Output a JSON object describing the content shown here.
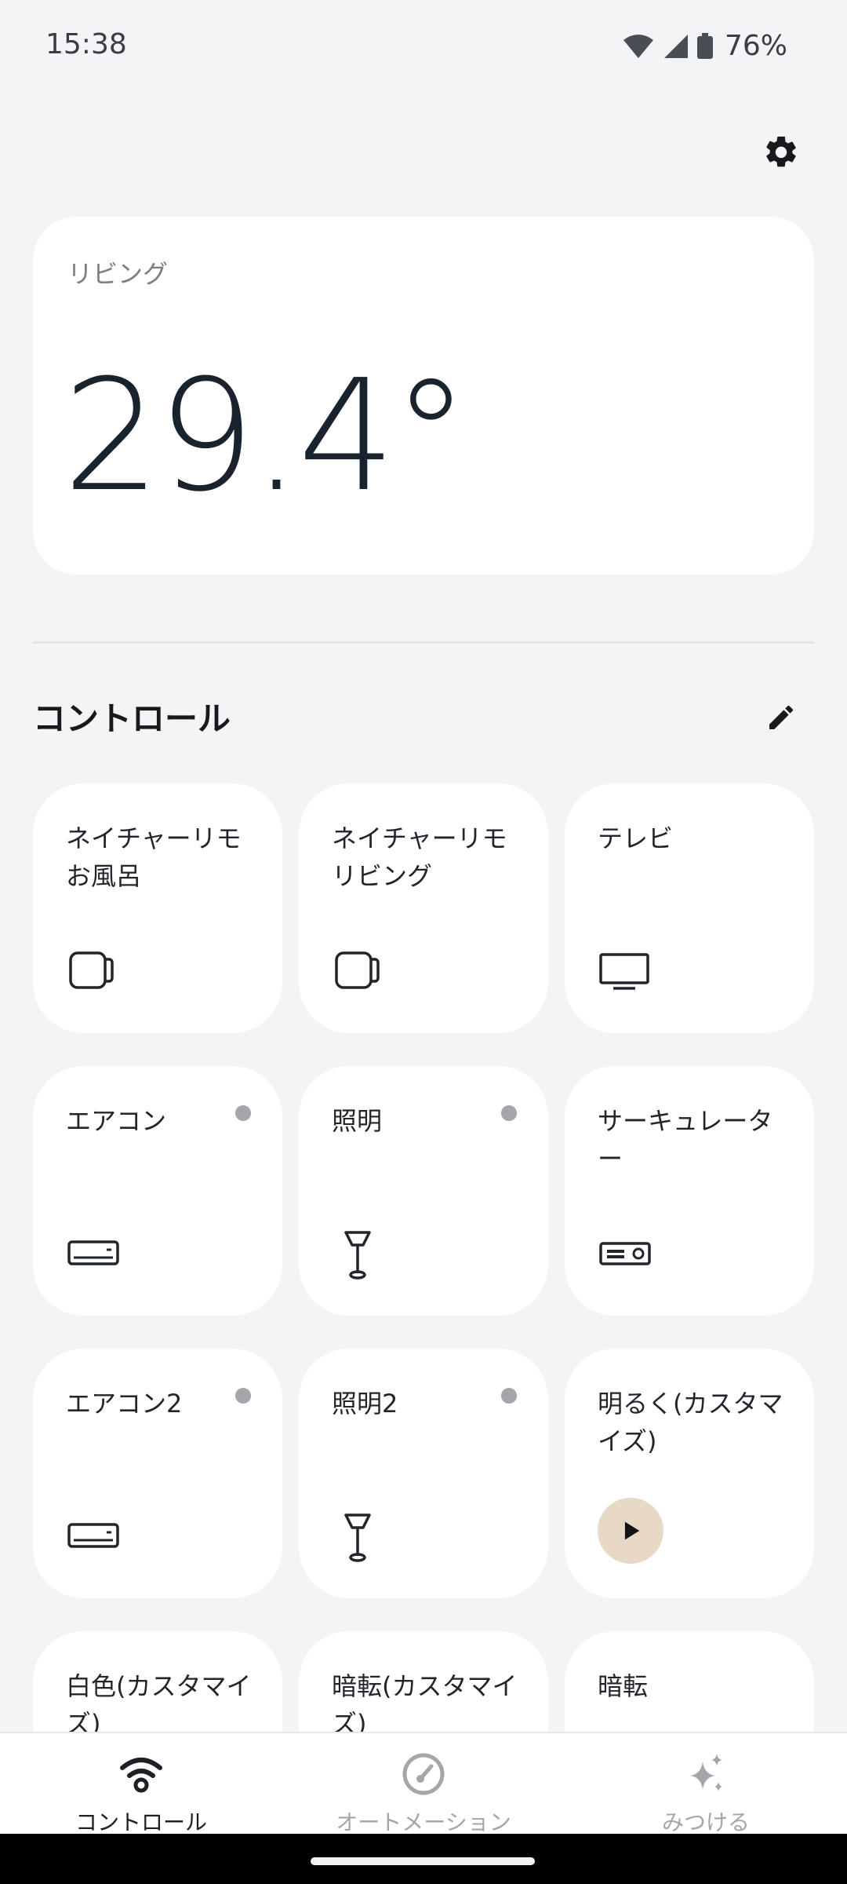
{
  "status_bar": {
    "time": "15:38",
    "battery": "76%"
  },
  "room": {
    "name": "リビング",
    "temperature": "29.4°"
  },
  "controls": {
    "title": "コントロール",
    "tiles": [
      {
        "label": "ネイチャーリモ\nお風呂",
        "icon": "remo-device-icon",
        "dot": false
      },
      {
        "label": "ネイチャーリモ\nリビング",
        "icon": "remo-device-icon",
        "dot": false
      },
      {
        "label": "テレビ",
        "icon": "tv-icon",
        "dot": false
      },
      {
        "label": "エアコン",
        "icon": "air-conditioner-icon",
        "dot": true
      },
      {
        "label": "照明",
        "icon": "lamp-icon",
        "dot": true
      },
      {
        "label": "サーキュレーター",
        "icon": "circulator-icon",
        "dot": false
      },
      {
        "label": "エアコン2",
        "icon": "air-conditioner-icon",
        "dot": true
      },
      {
        "label": "照明2",
        "icon": "lamp-icon",
        "dot": true
      },
      {
        "label": "明るく(カスタマイズ)",
        "icon": "play-icon",
        "dot": false
      },
      {
        "label": "白色(カスタマイズ)",
        "icon": "",
        "dot": false
      },
      {
        "label": "暗転(カスタマイズ)",
        "icon": "",
        "dot": false
      },
      {
        "label": "暗転",
        "icon": "",
        "dot": false
      }
    ]
  },
  "bottom_nav": {
    "items": [
      {
        "label": "コントロール",
        "icon": "wifi-icon",
        "active": true
      },
      {
        "label": "オートメーション",
        "icon": "gauge-icon",
        "active": false
      },
      {
        "label": "みつける",
        "icon": "sparkle-icon",
        "active": false
      }
    ]
  },
  "colors": {
    "background": "#f3f4f6",
    "card": "#ffffff",
    "play_accent": "#e7d9c6",
    "inactive_nav": "#a3a6ab"
  }
}
